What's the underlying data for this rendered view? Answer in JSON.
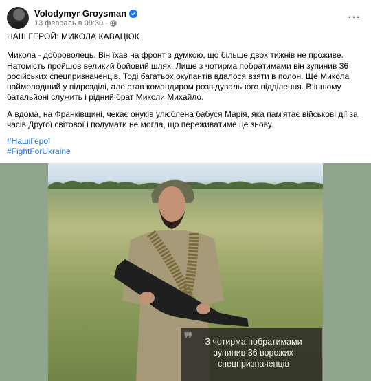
{
  "post": {
    "author": "Volodymyr Groysman",
    "timestamp": "13 февраль в 09:30",
    "separator": "·",
    "title": "НАШ ГЕРОЙ: МИКОЛА КАВАЦЮК",
    "paragraphs": [
      "Микола - доброволець. Він їхав на фронт з думкою, що більше двох тижнів не проживе. Натомість пройшов великий бойовий шлях. Лише з чотирма побратимами він зупинив 36 російських спецпризначенців. Тоді багатьох окупантів вдалося взяти в полон. Ще Микола наймолодший у підрозділі, але став командиром розвідувального відділення. В іншому батальйоні служить і рідний брат Миколи Михайло.",
      "А вдома, на Франківщині, чекає онуків улюблена бабуся Марія, яка пам'ятає військові дії за часів Другої світової і подумати не могла, що переживатиме це знову."
    ],
    "hashtags": [
      "#НашіГерої",
      "#FightForUkraine"
    ]
  },
  "photo": {
    "caption_lines": [
      "З чотирма побратимами",
      "зупинив 36 ворожих",
      "спецпризначенців"
    ]
  },
  "icons": {
    "verified": "verified-badge-icon",
    "privacy": "globe-icon",
    "more": "more-horizontal-icon",
    "quote": "quote-icon"
  },
  "colors": {
    "link": "#216fdb",
    "verified": "#1877f2",
    "secondary_text": "#65676b",
    "photo_background": "#91a58e",
    "caption_background": "#282622"
  }
}
